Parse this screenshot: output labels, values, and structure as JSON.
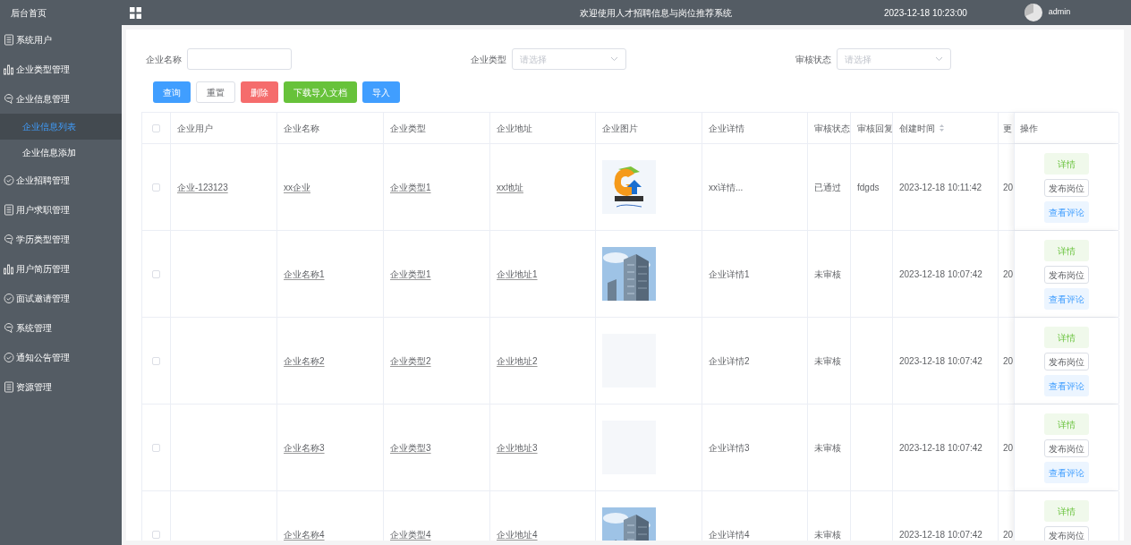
{
  "sidebar": {
    "home": "后台首页",
    "items": [
      {
        "label": "系统用户",
        "kind": "doc"
      },
      {
        "label": "企业类型管理",
        "kind": "chart"
      },
      {
        "label": "企业信息管理",
        "kind": "chat",
        "children": [
          {
            "label": "企业信息列表",
            "selected": true
          },
          {
            "label": "企业信息添加",
            "selected": false
          }
        ]
      },
      {
        "label": "企业招聘管理",
        "kind": "check"
      },
      {
        "label": "用户求职管理",
        "kind": "doc"
      },
      {
        "label": "学历类型管理",
        "kind": "chat"
      },
      {
        "label": "用户简历管理",
        "kind": "chart"
      },
      {
        "label": "面试邀请管理",
        "kind": "check"
      },
      {
        "label": "系统管理",
        "kind": "chat"
      },
      {
        "label": "通知公告管理",
        "kind": "check"
      },
      {
        "label": "资源管理",
        "kind": "doc"
      }
    ]
  },
  "header": {
    "title": "欢迎使用人才招聘信息与岗位推荐系统",
    "datetime": "2023-12-18 10:23:00",
    "user": "admin"
  },
  "filters": [
    {
      "label": "企业名称",
      "kind": "input"
    },
    {
      "label": "企业类型",
      "kind": "select",
      "placeholder": "请选择"
    },
    {
      "label": "审核状态",
      "kind": "select",
      "placeholder": "请选择"
    }
  ],
  "buttons": [
    {
      "label": "查询",
      "kind": "primary"
    },
    {
      "label": "重置",
      "kind": "plain"
    },
    {
      "label": "删除",
      "kind": "danger"
    },
    {
      "label": "下载导入文档",
      "kind": "success"
    },
    {
      "label": "导入",
      "kind": "primary"
    }
  ],
  "table": {
    "select_all": false,
    "columns": [
      "企业用户",
      "企业名称",
      "企业类型",
      "企业地址",
      "企业图片",
      "企业详情",
      "审核状态",
      "审核回复",
      "创建时间",
      "更",
      "操作"
    ],
    "rows": [
      {
        "checked": false,
        "user": "企业-123123",
        "name": "xx企业",
        "type": "企业类型1",
        "address": "xx地址",
        "image": {
          "kind": "logo"
        },
        "detail": "xx详情...",
        "status": "已通过",
        "reply": "fdgds",
        "created": "2023-12-18 10:11:42",
        "column_10": "20",
        "actions": [
          "详情",
          "发布岗位",
          "查看评论"
        ]
      },
      {
        "checked": false,
        "name": "企业名称1",
        "type": "企业类型1",
        "address": "企业地址1",
        "image": {
          "kind": "picture"
        },
        "detail": "企业详情1",
        "status": "未审核",
        "created": "2023-12-18 10:07:42",
        "column_10": "20",
        "actions": [
          "详情",
          "发布岗位",
          "查看评论"
        ]
      },
      {
        "checked": false,
        "name": "企业名称2",
        "type": "企业类型2",
        "address": "企业地址2",
        "image": {
          "kind": "empty"
        },
        "detail": "企业详情2",
        "status": "未审核",
        "created": "2023-12-18 10:07:42",
        "column_10": "20",
        "actions": [
          "详情",
          "发布岗位",
          "查看评论"
        ]
      },
      {
        "checked": false,
        "name": "企业名称3",
        "type": "企业类型3",
        "address": "企业地址3",
        "image": {
          "kind": "empty"
        },
        "detail": "企业详情3",
        "status": "未审核",
        "created": "2023-12-18 10:07:42",
        "column_10": "20",
        "actions": [
          "详情",
          "发布岗位",
          "查看评论"
        ]
      },
      {
        "checked": false,
        "name": "企业名称4",
        "type": "企业类型4",
        "address": "企业地址4",
        "image": {
          "kind": "picture"
        },
        "detail": "企业详情4",
        "status": "未审核",
        "created": "2023-12-18 10:07:42",
        "column_10": "20",
        "actions": [
          "详情",
          "发布岗位"
        ]
      }
    ]
  }
}
